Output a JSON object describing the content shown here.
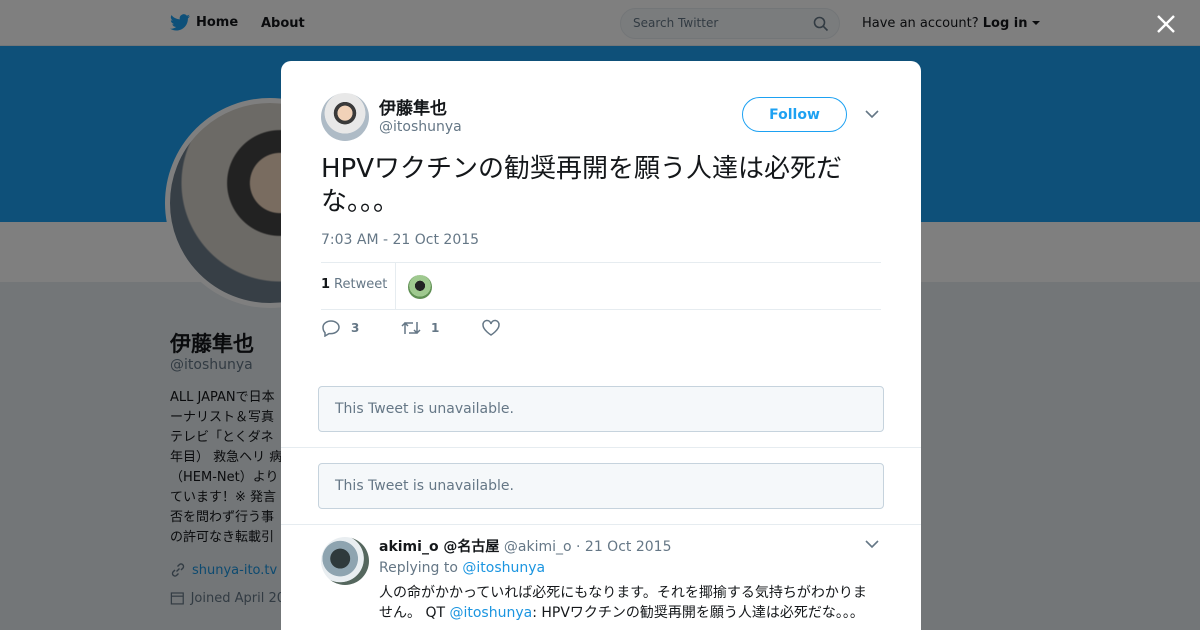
{
  "colors": {
    "brand": "#1da1f2",
    "link": "#1b95e0"
  },
  "topbar": {
    "home_label": "Home",
    "about_label": "About",
    "search_placeholder": "Search Twitter",
    "account_prompt": "Have an account?",
    "login_label": "Log in"
  },
  "profile": {
    "name": "伊藤隼也",
    "handle": "@itoshunya",
    "bio": "ALL JAPANで日本\nーナリスト＆写真\nテレビ「とくダネ\n年目） 救急ヘリ 病\n（HEM-Net）より\nています！※ 発言\n否を問わず行う事\nの許可なき転載引",
    "website": "shunya-ito.tv",
    "joined": "Joined April 20"
  },
  "tweet": {
    "author_name": "伊藤隼也",
    "author_handle": "@itoshunya",
    "follow_label": "Follow",
    "text": "HPVワクチンの勧奨再開を願う人達は必死だな。。。",
    "timestamp": "7:03 AM - 21 Oct 2015",
    "retweet_count": "1",
    "retweet_label": "Retweet",
    "reply_count": "3",
    "retweet_action_count": "1"
  },
  "unavailable": [
    {
      "text": "This Tweet is unavailable."
    },
    {
      "text": "This Tweet is unavailable."
    }
  ],
  "reply": {
    "author_name": "akimi_o @名古屋",
    "author_handle": "@akimi_o",
    "separator": "·",
    "date": "21 Oct 2015",
    "replying_label": "Replying to",
    "replying_to": "@itoshunya",
    "text_before": "人の命がかかっていれば必死にもなります。それを揶揄する気持ちがわかりません。 QT ",
    "quoted_handle": "@itoshunya",
    "text_after": ": HPVワクチンの勧奨再開を願う人達は必死だな。。。"
  },
  "icons": [
    "twitter-bird-icon",
    "search-icon",
    "caret-down-icon",
    "close-icon",
    "link-icon",
    "calendar-icon",
    "chevron-down-icon",
    "reply-icon",
    "retweet-icon",
    "heart-icon"
  ]
}
